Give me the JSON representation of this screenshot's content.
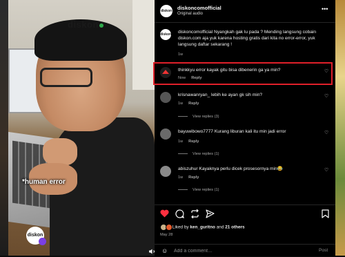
{
  "video": {
    "watermark": "diskon",
    "caption": "*human error",
    "logo_text": "diskon"
  },
  "header": {
    "username": "diskoncomofficial",
    "subtitle": "Original audio",
    "avatar_text": "diskon"
  },
  "caption": {
    "username": "diskoncomofficial",
    "text": "Nyangkah gak lu pada ? Mending langsung cobain diskon.com aja yuk karena hosting gratis dari kita no error-error, yuk langsung daftar sekarang !",
    "time": "1w"
  },
  "comments": [
    {
      "username": "thinkkyu",
      "text": "error kayak gitu bisa dibenerin ga ya min?",
      "time": "Now",
      "reply_label": "Reply",
      "replies": ""
    },
    {
      "username": "krisnawanryan_",
      "text": "lebih ke ayan gk sih min?",
      "time": "1w",
      "reply_label": "Reply",
      "replies": "View replies (3)"
    },
    {
      "username": "bayuwibowo7777",
      "text": "Kurang liburan kali itu min jadi error",
      "time": "1w",
      "reply_label": "Reply",
      "replies": "View replies (1)"
    },
    {
      "username": "abiszuhur",
      "text": "Kayaknya perlu dicek prosesornya min😂",
      "time": "1w",
      "reply_label": "Reply",
      "replies": "View replies (1)"
    }
  ],
  "actions": {
    "liked_by_prefix": "Liked by",
    "liked_by_user": "ken_guritno",
    "and_label": "and",
    "others": "21 others",
    "date": "May 28",
    "comment_placeholder": "Add a comment…",
    "post_label": "Post"
  },
  "colors": {
    "like": "#ff3040",
    "highlight": "#e0202a"
  }
}
